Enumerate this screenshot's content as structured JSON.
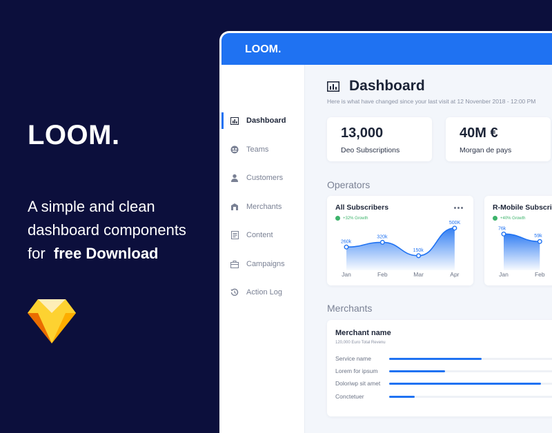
{
  "promo": {
    "logo": "LOOM.",
    "tagline_line1": "A simple and clean",
    "tagline_line2": "dashboard components",
    "tagline_for": "for",
    "tagline_bold": "free Download"
  },
  "app": {
    "brand": "LOOM.",
    "accent": "#1f72f2"
  },
  "sidebar": {
    "items": [
      {
        "label": "Dashboard",
        "icon": "bar-chart-icon",
        "active": true
      },
      {
        "label": "Teams",
        "icon": "teams-icon"
      },
      {
        "label": "Customers",
        "icon": "user-icon"
      },
      {
        "label": "Merchants",
        "icon": "store-icon"
      },
      {
        "label": "Content",
        "icon": "document-icon"
      },
      {
        "label": "Campaigns",
        "icon": "briefcase-icon"
      },
      {
        "label": "Action Log",
        "icon": "history-icon"
      }
    ]
  },
  "header": {
    "title": "Dashboard",
    "subtitle": "Here is what have changed since your last visit at 12 Novenber 2018 - 12:00 PM"
  },
  "stats": [
    {
      "value": "13,000",
      "label": "Deo Subscriptions"
    },
    {
      "value": "40M €",
      "label": "Morgan de pays"
    }
  ],
  "operators": {
    "title": "Operators",
    "cards": [
      {
        "title": "All Subscribers",
        "growth": "+32% Growth"
      },
      {
        "title": "R-Mobile Subscribers",
        "growth": "+40% Growth"
      }
    ]
  },
  "chart_data": [
    {
      "type": "area",
      "title": "All Subscribers",
      "categories": [
        "Jan",
        "Feb",
        "Mar",
        "Apr"
      ],
      "values": [
        260,
        320,
        150,
        500
      ],
      "data_labels": [
        "260k",
        "320k",
        "150k",
        "500K"
      ],
      "ylim": [
        0,
        560
      ],
      "grid": false
    },
    {
      "type": "area",
      "title": "R-Mobile Subscribers",
      "categories": [
        "Jan",
        "Feb"
      ],
      "values": [
        76,
        59
      ],
      "data_labels": [
        "76k",
        "59k"
      ],
      "ylim": [
        0,
        100
      ],
      "grid": false
    }
  ],
  "merchants": {
    "title": "Merchants",
    "card": {
      "name": "Merchant name",
      "subtitle": "120,000 Euro Total Revenu",
      "rows": [
        {
          "label": "Service name",
          "value": 0.51
        },
        {
          "label": "Lorem for ipsum",
          "value": 0.31
        },
        {
          "label": "Doloriwp sit amet",
          "value": 0.84
        },
        {
          "label": "Conctetuer",
          "value": 0.14
        }
      ]
    }
  }
}
